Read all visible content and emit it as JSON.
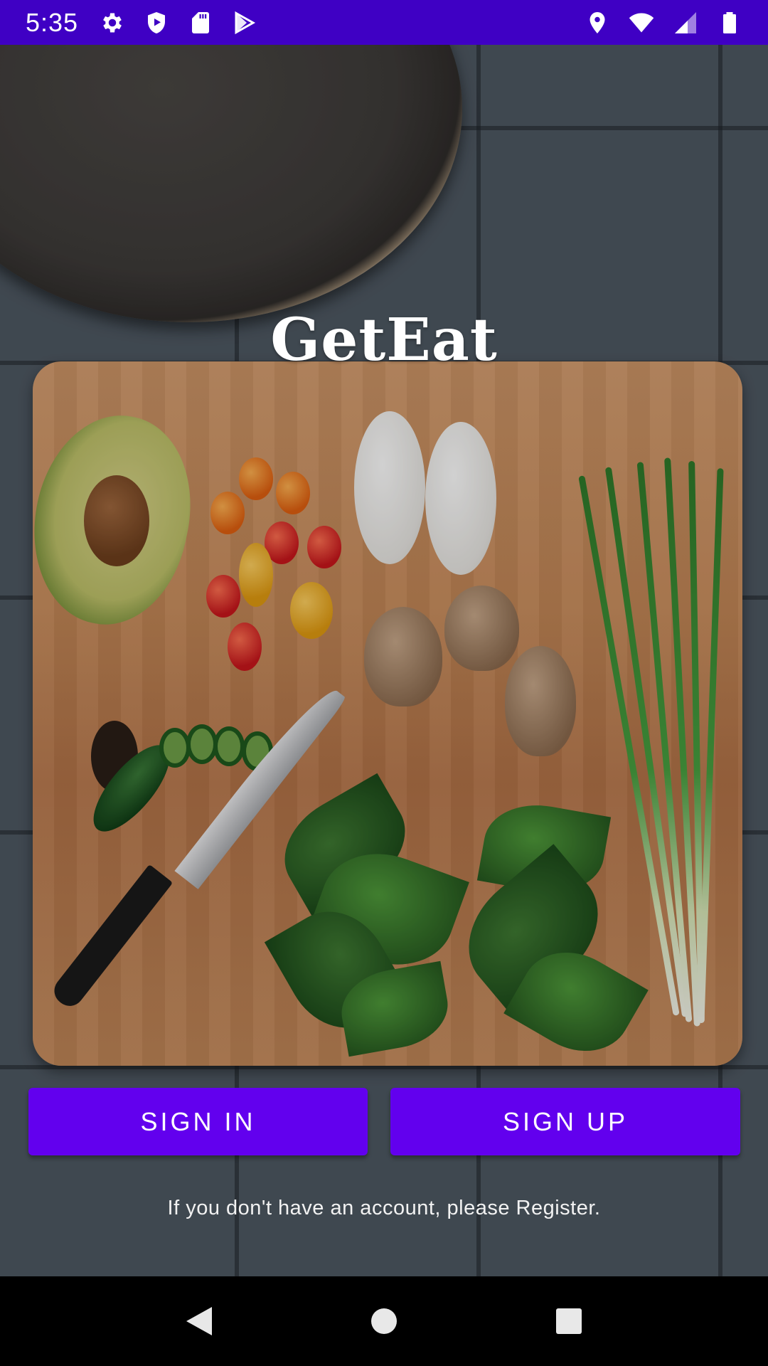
{
  "status_bar": {
    "time": "5:35",
    "left_icons": [
      "settings-icon",
      "shield-play-icon",
      "sd-card-icon",
      "play-store-icon"
    ],
    "right_icons": [
      "location-icon",
      "wifi-icon",
      "signal-icon",
      "battery-icon"
    ],
    "background_color": "#3f00c4"
  },
  "app": {
    "title": "GetEat",
    "background_image": "cutting board with avocado, tomatoes, eggs, mushrooms, spinach, green onions, knife and pan on tiled floor"
  },
  "buttons": {
    "sign_in": "SIGN IN",
    "sign_up": "SIGN UP",
    "color": "#6200ee"
  },
  "hint_text": "If you don't have an account, please Register.",
  "navigation": {
    "back": "back-icon",
    "home": "home-icon",
    "recents": "recents-icon"
  }
}
